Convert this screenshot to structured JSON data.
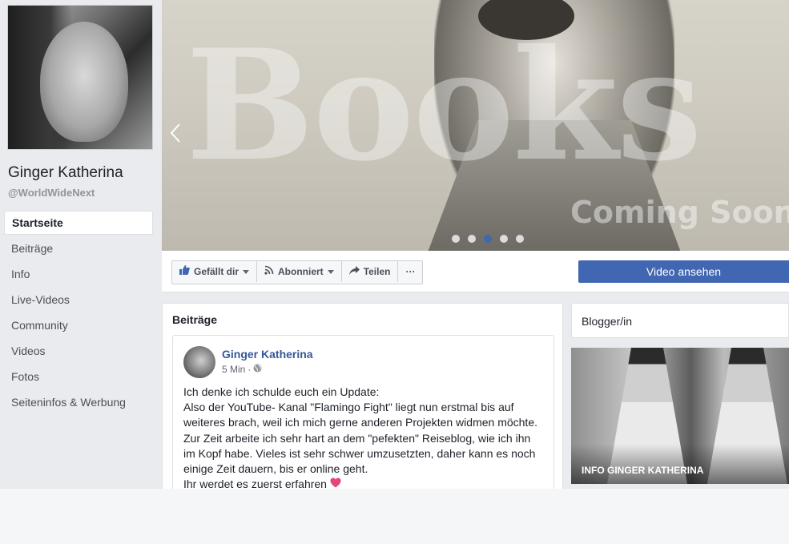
{
  "profile": {
    "name": "Ginger Katherina",
    "handle": "@WorldWideNext"
  },
  "sidebar": {
    "items": [
      {
        "label": "Startseite",
        "active": true
      },
      {
        "label": "Beiträge"
      },
      {
        "label": "Info"
      },
      {
        "label": "Live-Videos"
      },
      {
        "label": "Community"
      },
      {
        "label": "Videos"
      },
      {
        "label": "Fotos"
      },
      {
        "label": "Seiteninfos & Werbung"
      }
    ]
  },
  "cover": {
    "big_text": "Books",
    "sub_text": "Coming Soon",
    "slide_count": 5,
    "active_slide": 3
  },
  "actions": {
    "like_label": "Gefällt dir",
    "subscribe_label": "Abonniert",
    "share_label": "Teilen",
    "more_label": "···",
    "cta_label": "Video ansehen"
  },
  "posts": {
    "title": "Beiträge",
    "post": {
      "author": "Ginger Katherina",
      "time": "5 Min",
      "separator": "·",
      "lines": [
        "Ich denke ich schulde euch ein Update:",
        "Also der YouTube- Kanal \"Flamingo Fight\" liegt nun erstmal bis auf weiteres brach, weil ich mich gerne anderen Projekten widmen möchte.",
        "Zur Zeit arbeite ich sehr hart an dem \"pefekten\" Reiseblog, wie ich ihn im Kopf habe. Vieles ist sehr schwer umzusetzten, daher kann es noch einige Zeit dauern, bis er online geht.",
        "Ihr werdet es zuerst erfahren"
      ],
      "emoji": "heart"
    }
  },
  "right": {
    "category": "Blogger/in",
    "info_label": "INFO GINGER KATHERINA"
  },
  "colors": {
    "brand_blue": "#4267b2",
    "link_blue": "#365899",
    "page_bg": "#e9ebee"
  }
}
